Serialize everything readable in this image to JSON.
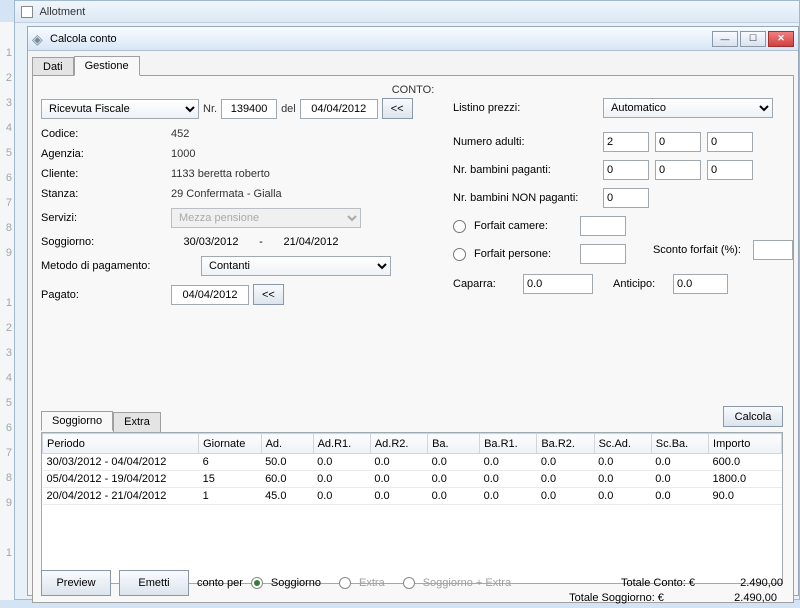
{
  "outer_window": {
    "title": "Allotment"
  },
  "inner_window": {
    "title": "Calcola conto"
  },
  "tabs_main": {
    "dati": "Dati",
    "gestione": "Gestione"
  },
  "heading": "CONTO:",
  "doc": {
    "tipo": "Ricevuta Fiscale",
    "nr_label": "Nr.",
    "nr": "139400",
    "del_label": "del",
    "del": "04/04/2012",
    "back": "<<"
  },
  "left": {
    "codice_k": "Codice:",
    "codice_v": "452",
    "agenzia_k": "Agenzia:",
    "agenzia_v": "1000",
    "cliente_k": "Cliente:",
    "cliente_v": "1133 beretta roberto",
    "stanza_k": "Stanza:",
    "stanza_v": "29 Confermata - Gialla",
    "servizi_k": "Servizi:",
    "servizi_v": "Mezza pensione",
    "soggiorno_k": "Soggiorno:",
    "soggiorno_from": "30/03/2012",
    "soggiorno_sep": "-",
    "soggiorno_to": "21/04/2012",
    "metodo_k": "Metodo di pagamento:",
    "metodo_v": "Contanti",
    "pagato_k": "Pagato:",
    "pagato_v": "04/04/2012",
    "pagato_back": "<<"
  },
  "right": {
    "listino_k": "Listino prezzi:",
    "listino_v": "Automatico",
    "adulti_k": "Numero adulti:",
    "adulti": [
      "2",
      "0",
      "0"
    ],
    "bambpag_k": "Nr. bambini paganti:",
    "bambpag": [
      "0",
      "0",
      "0"
    ],
    "bambnon_k": "Nr. bambini NON paganti:",
    "bambnon": "0",
    "forfait_camere": "Forfait camere:",
    "forfait_persone": "Forfait persone:",
    "sconto_k": "Sconto forfait (%):",
    "caparra_k": "Caparra:",
    "caparra_v": "0.0",
    "anticipo_k": "Anticipo:",
    "anticipo_v": "0.0"
  },
  "calc_btn": "Calcola",
  "subtabs": {
    "soggiorno": "Soggiorno",
    "extra": "Extra"
  },
  "grid": {
    "headers": [
      "Periodo",
      "Giornate",
      "Ad.",
      "Ad.R1.",
      "Ad.R2.",
      "Ba.",
      "Ba.R1.",
      "Ba.R2.",
      "Sc.Ad.",
      "Sc.Ba.",
      "Importo"
    ],
    "rows": [
      [
        "30/03/2012 - 04/04/2012",
        "6",
        "50.0",
        "0.0",
        "0.0",
        "0.0",
        "0.0",
        "0.0",
        "0.0",
        "0.0",
        "600.0"
      ],
      [
        "05/04/2012 - 19/04/2012",
        "15",
        "60.0",
        "0.0",
        "0.0",
        "0.0",
        "0.0",
        "0.0",
        "0.0",
        "0.0",
        "1800.0"
      ],
      [
        "20/04/2012 - 21/04/2012",
        "1",
        "45.0",
        "0.0",
        "0.0",
        "0.0",
        "0.0",
        "0.0",
        "0.0",
        "0.0",
        "90.0"
      ]
    ]
  },
  "totals": {
    "soggiorno_k": "Totale Soggiorno: €",
    "soggiorno_v": "2.490,00",
    "conto_k": "Totale Conto: €",
    "conto_v": "2.490,00"
  },
  "footer": {
    "preview": "Preview",
    "emetti": "Emetti",
    "conto_per": "conto per",
    "opt_soggiorno": "Soggiorno",
    "opt_extra": "Extra",
    "opt_both": "Soggiorno + Extra"
  },
  "chart_data": {
    "type": "table",
    "title": "Soggiorno",
    "columns": [
      "Periodo",
      "Giornate",
      "Ad.",
      "Ad.R1.",
      "Ad.R2.",
      "Ba.",
      "Ba.R1.",
      "Ba.R2.",
      "Sc.Ad.",
      "Sc.Ba.",
      "Importo"
    ],
    "rows": [
      {
        "Periodo": "30/03/2012 - 04/04/2012",
        "Giornate": 6,
        "Ad.": 50.0,
        "Ad.R1.": 0.0,
        "Ad.R2.": 0.0,
        "Ba.": 0.0,
        "Ba.R1.": 0.0,
        "Ba.R2.": 0.0,
        "Sc.Ad.": 0.0,
        "Sc.Ba.": 0.0,
        "Importo": 600.0
      },
      {
        "Periodo": "05/04/2012 - 19/04/2012",
        "Giornate": 15,
        "Ad.": 60.0,
        "Ad.R1.": 0.0,
        "Ad.R2.": 0.0,
        "Ba.": 0.0,
        "Ba.R1.": 0.0,
        "Ba.R2.": 0.0,
        "Sc.Ad.": 0.0,
        "Sc.Ba.": 0.0,
        "Importo": 1800.0
      },
      {
        "Periodo": "20/04/2012 - 21/04/2012",
        "Giornate": 1,
        "Ad.": 45.0,
        "Ad.R1.": 0.0,
        "Ad.R2.": 0.0,
        "Ba.": 0.0,
        "Ba.R1.": 0.0,
        "Ba.R2.": 0.0,
        "Sc.Ad.": 0.0,
        "Sc.Ba.": 0.0,
        "Importo": 90.0
      }
    ],
    "totals": {
      "Totale Soggiorno €": 2490.0,
      "Totale Conto €": 2490.0
    }
  }
}
